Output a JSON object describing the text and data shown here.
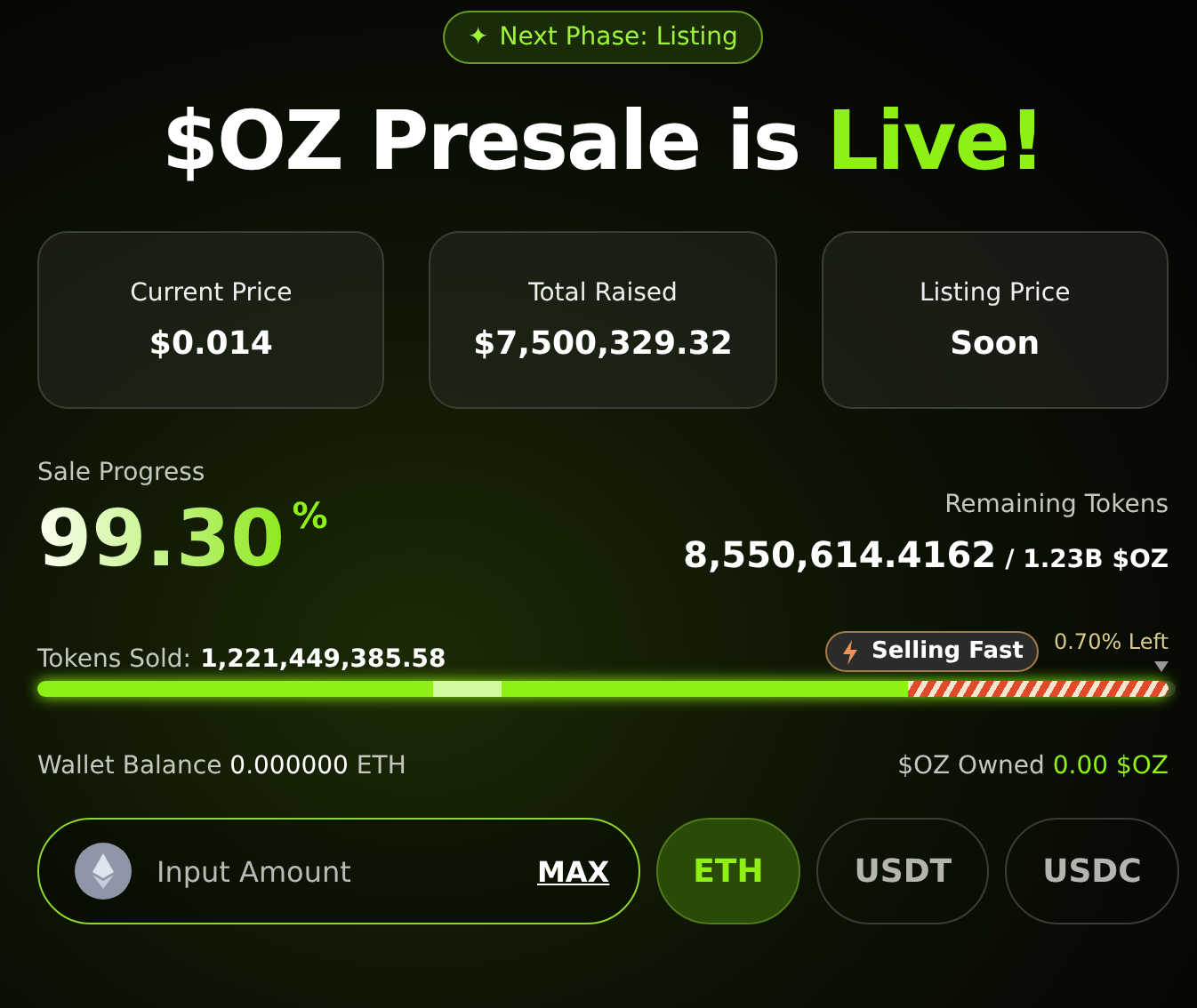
{
  "phase_badge": {
    "icon": "✦",
    "label": "Next Phase: Listing"
  },
  "title": {
    "main": "$OZ Presale is",
    "accent": "Live!"
  },
  "stats": [
    {
      "label": "Current Price",
      "value": "$0.014"
    },
    {
      "label": "Total Raised",
      "value": "$7,500,329.32"
    },
    {
      "label": "Listing Price",
      "value": "Soon"
    }
  ],
  "progress": {
    "label": "Sale Progress",
    "percent": "99.30",
    "percent_sign": "%",
    "remaining_label": "Remaining Tokens",
    "remaining_value": "8,550,614.4162",
    "remaining_total": "/ 1.23B $OZ",
    "sold_label": "Tokens Sold:",
    "sold_value": "1,221,449,385.58",
    "selling_fast": "Selling Fast",
    "left": "0.70% Left",
    "level": 0.993
  },
  "wallet": {
    "balance_label": "Wallet Balance",
    "balance_value": "0.000000",
    "balance_unit": "ETH",
    "owned_label": "$OZ Owned",
    "owned_value": "0.00 $OZ"
  },
  "amount": {
    "placeholder": "Input Amount",
    "max": "MAX"
  },
  "currencies": [
    {
      "label": "ETH",
      "selected": true
    },
    {
      "label": "USDT",
      "selected": false
    },
    {
      "label": "USDC",
      "selected": false
    }
  ]
}
